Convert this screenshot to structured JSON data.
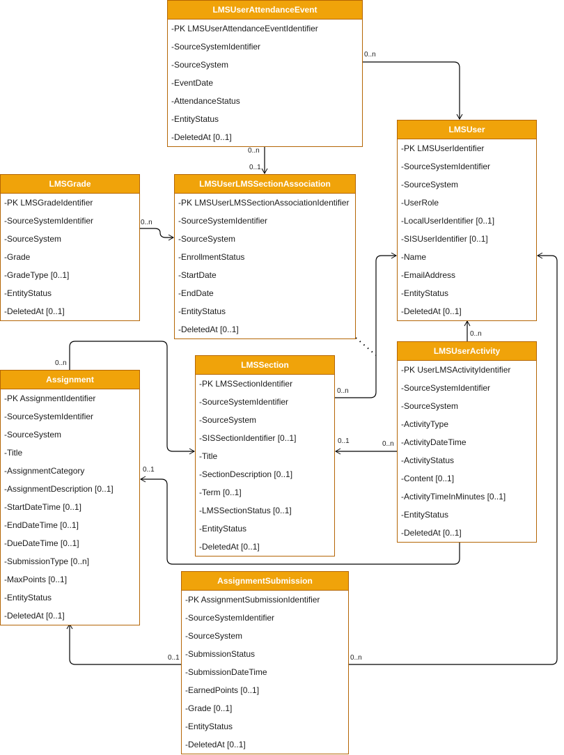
{
  "diagram": {
    "colors": {
      "header_fill": "#f0a30a",
      "border": "#b46504",
      "header_text": "#ffffff",
      "connector": "#000000"
    },
    "entities": {
      "attendance": {
        "title": "LMSUserAttendanceEvent",
        "attributes": [
          "-PK LMSUserAttendanceEventIdentifier",
          "-SourceSystemIdentifier",
          "-SourceSystem",
          "-EventDate",
          "-AttendanceStatus",
          "-EntityStatus",
          "-DeletedAt [0..1]"
        ]
      },
      "user": {
        "title": "LMSUser",
        "attributes": [
          "-PK LMSUserIdentifier",
          "-SourceSystemIdentifier",
          "-SourceSystem",
          "-UserRole",
          "-LocalUserIdentifier [0..1]",
          "-SISUserIdentifier [0..1]",
          "-Name",
          "-EmailAddress",
          "-EntityStatus",
          "-DeletedAt [0..1]"
        ]
      },
      "grade": {
        "title": "LMSGrade",
        "attributes": [
          "-PK LMSGradeIdentifier",
          "-SourceSystemIdentifier",
          "-SourceSystem",
          "-Grade",
          "-GradeType [0..1]",
          "-EntityStatus",
          "-DeletedAt [0..1]"
        ]
      },
      "association": {
        "title": "LMSUserLMSSectionAssociation",
        "attributes": [
          "-PK LMSUserLMSSectionAssociationIdentifier",
          "-SourceSystemIdentifier",
          "-SourceSystem",
          "-EnrollmentStatus",
          "-StartDate",
          "-EndDate",
          "-EntityStatus",
          "-DeletedAt [0..1]"
        ]
      },
      "assignment": {
        "title": "Assignment",
        "attributes": [
          "-PK AssignmentIdentifier",
          "-SourceSystemIdentifier",
          "-SourceSystem",
          "-Title",
          "-AssignmentCategory",
          "-AssignmentDescription [0..1]",
          "-StartDateTime [0..1]",
          "-EndDateTime [0..1]",
          "-DueDateTime [0..1]",
          "-SubmissionType [0..n]",
          "-MaxPoints [0..1]",
          "-EntityStatus",
          "-DeletedAt [0..1]"
        ]
      },
      "section": {
        "title": "LMSSection",
        "attributes": [
          "-PK LMSSectionIdentifier",
          "-SourceSystemIdentifier",
          "-SourceSystem",
          "-SISSectionIdentifier [0..1]",
          "-Title",
          "-SectionDescription [0..1]",
          "-Term [0..1]",
          "-LMSSectionStatus [0..1]",
          "-EntityStatus",
          "-DeletedAt [0..1]"
        ]
      },
      "activity": {
        "title": "LMSUserActivity",
        "attributes": [
          "-PK UserLMSActivityIdentifier",
          "-SourceSystemIdentifier",
          "-SourceSystem",
          "-ActivityType",
          "-ActivityDateTime",
          "-ActivityStatus",
          "-Content [0..1]",
          "-ActivityTimeInMinutes [0..1]",
          "-EntityStatus",
          "-DeletedAt [0..1]"
        ]
      },
      "submission": {
        "title": "AssignmentSubmission",
        "attributes": [
          "-PK AssignmentSubmissionIdentifier",
          "-SourceSystemIdentifier",
          "-SourceSystem",
          "-SubmissionStatus",
          "-SubmissionDateTime",
          "-EarnedPoints [0..1]",
          "-Grade [0..1]",
          "-EntityStatus",
          "-DeletedAt [0..1]"
        ]
      }
    },
    "relationships": [
      {
        "from": "LMSUserAttendanceEvent",
        "to": "LMSUser",
        "from_card": "0..n",
        "to_card": ""
      },
      {
        "from": "LMSUserAttendanceEvent",
        "to": "LMSUserLMSSectionAssociation",
        "from_card": "0..n",
        "to_card": "0..1"
      },
      {
        "from": "LMSGrade",
        "to": "LMSUserLMSSectionAssociation",
        "from_card": "0..n",
        "to_card": ""
      },
      {
        "from": "LMSSection",
        "to": "LMSUser",
        "from_card": "0..n",
        "to_card": ""
      },
      {
        "from": "Assignment",
        "to": "LMSSection",
        "from_card": "0..n",
        "to_card": ""
      },
      {
        "from": "LMSUserActivity",
        "to": "LMSSection",
        "from_card": "0..n",
        "to_card": "0..1"
      },
      {
        "from": "LMSUserActivity",
        "to": "LMSUser",
        "from_card": "0..n",
        "to_card": ""
      },
      {
        "from": "LMSUserActivity",
        "to": "Assignment",
        "from_card": "",
        "to_card": "0..1"
      },
      {
        "from": "AssignmentSubmission",
        "to": "Assignment",
        "from_card": "0..1",
        "to_card": ""
      },
      {
        "from": "AssignmentSubmission",
        "to": "LMSUser",
        "from_card": "0..n",
        "to_card": ""
      }
    ],
    "cardinality_labels": {
      "att_user": "0..n",
      "att_assoc_from": "0..n",
      "att_assoc_to": "0..1",
      "grade_assoc": "0..n",
      "assign_section": "0..n",
      "section_user": "0..n",
      "activity_section_to": "0..1",
      "activity_section_from": "0..n",
      "activity_user": "0..n",
      "activity_assign_to": "0..1",
      "sub_assign": "0..1",
      "sub_user": "0..n"
    }
  }
}
